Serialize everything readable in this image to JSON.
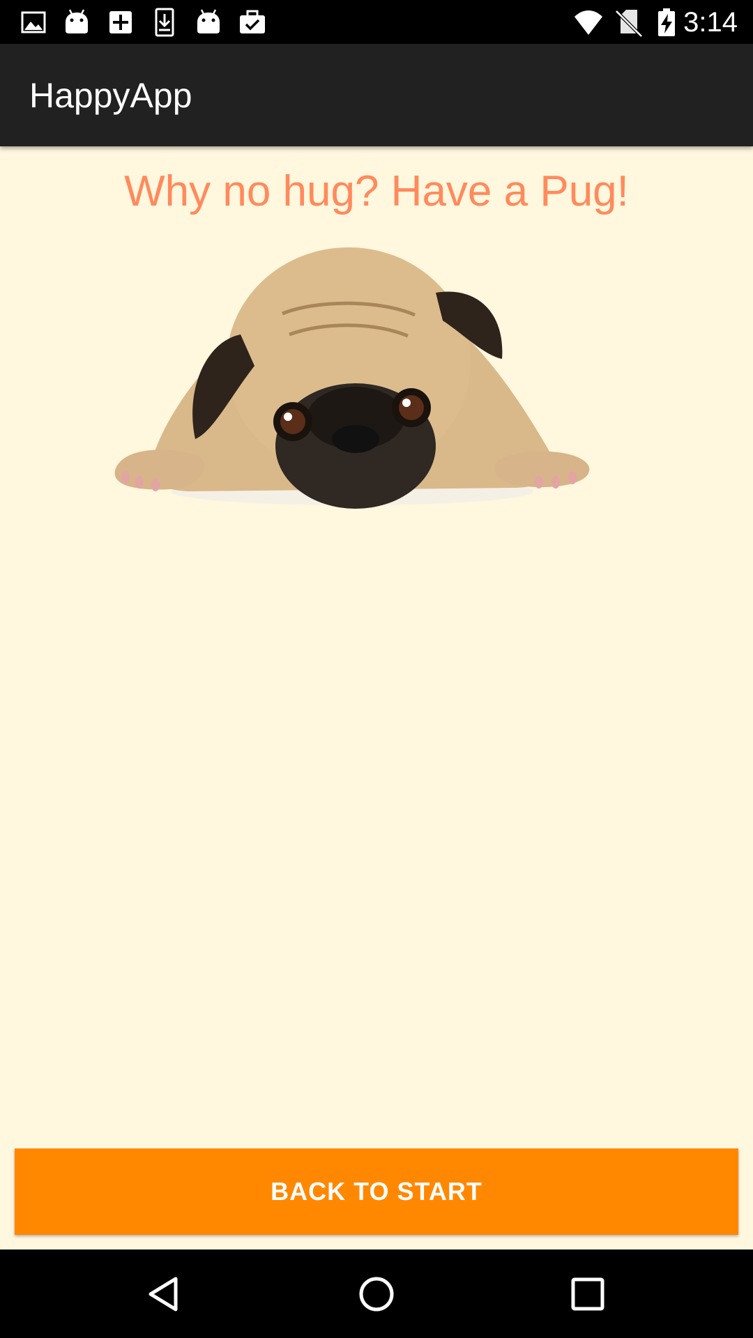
{
  "status_bar": {
    "time": "3:14",
    "notification_icons": [
      "image-icon",
      "android-icon",
      "add-box-icon",
      "download-icon",
      "android-icon",
      "work-check-icon"
    ],
    "system_icons": [
      "wifi-icon",
      "no-sim-icon",
      "battery-charging-icon"
    ]
  },
  "app_bar": {
    "title": "HappyApp"
  },
  "main": {
    "headline": "Why no hug? Have a Pug!",
    "button_label": "BACK TO START"
  },
  "nav_bar": {
    "buttons": [
      "back-icon",
      "home-icon",
      "recents-icon"
    ]
  },
  "colors": {
    "background": "#fff7de",
    "app_bar": "#212121",
    "headline": "#ff8a5c",
    "button": "#ff8800"
  }
}
